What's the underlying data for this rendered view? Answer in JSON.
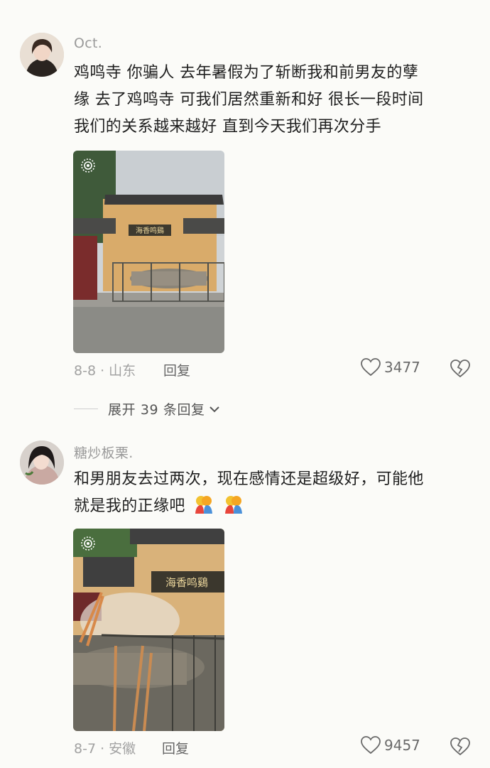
{
  "comments": [
    {
      "username": "Oct.",
      "text_lines": [
        "鸡鸣寺 你骗人 去年暑假为了斩断我和前男友的孽",
        "缘 去了鸡鸣寺 可我们居然重新和好 很长一段时间",
        "我们的关系越来越好 直到今天我们再次分手"
      ],
      "photo_sign": "海香鸣鷄",
      "date_location": "8-8 · 山东",
      "reply_label": "回复",
      "like_count": "3477"
    },
    {
      "username": "糖炒板栗.",
      "text_lines": [
        "和男朋友去过两次，现在感情还是超级好，可能他",
        "就是我的正缘吧"
      ],
      "emojis": [
        "hugging-couple-emoji",
        "hugging-couple-emoji"
      ],
      "photo_sign": "海香鸣鷄",
      "date_location": "8-7 · 安徽",
      "reply_label": "回复",
      "like_count": "9457"
    }
  ],
  "expand_replies": "展开 39 条回复",
  "icons": {
    "like": "heart-outline-icon",
    "dislike": "broken-heart-icon",
    "expand": "chevron-down-icon",
    "live_photo": "live-photo-icon"
  },
  "colors": {
    "background": "#fbfbf8",
    "text": "#1f1f1f",
    "muted": "#a2a2a2"
  }
}
